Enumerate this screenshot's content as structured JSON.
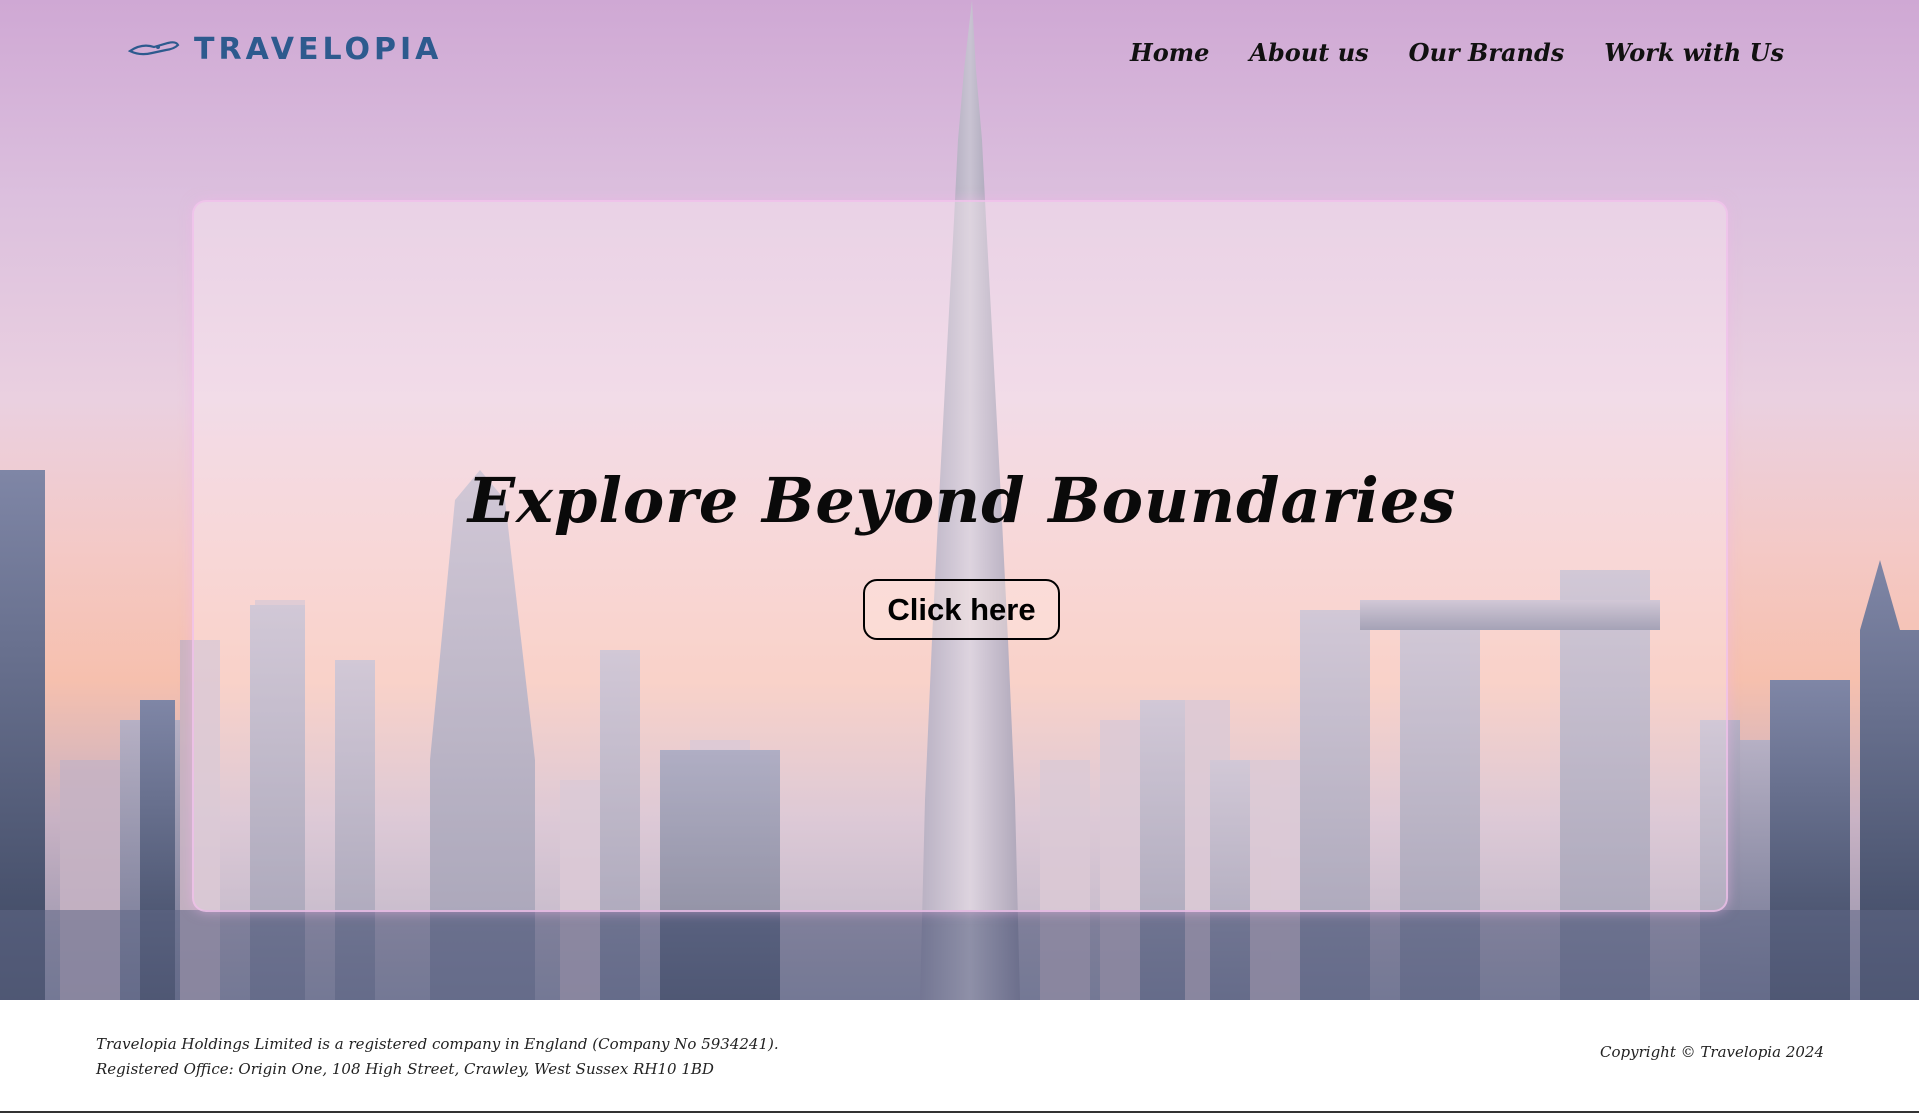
{
  "colors": {
    "brand": "#2d5a8e",
    "nav_text": "#111111",
    "headline": "#0a0a0a",
    "footer_bg": "#ffffff"
  },
  "header": {
    "brand_name": "TRAVELOPIA",
    "logo_icon": "airplane-icon",
    "nav": [
      {
        "label": "Home"
      },
      {
        "label": "About us"
      },
      {
        "label": "Our Brands"
      },
      {
        "label": "Work with Us"
      }
    ]
  },
  "hero": {
    "headline": "Explore Beyond Boundaries",
    "cta_label": "Click here",
    "background": "city-skyline-image"
  },
  "footer": {
    "line1": "Travelopia Holdings Limited is a registered company in England (Company No 5934241).",
    "line2": "Registered Office: Origin One, 108 High Street, Crawley, West Sussex RH10 1BD",
    "copyright": "Copyright © Travelopia 2024"
  }
}
